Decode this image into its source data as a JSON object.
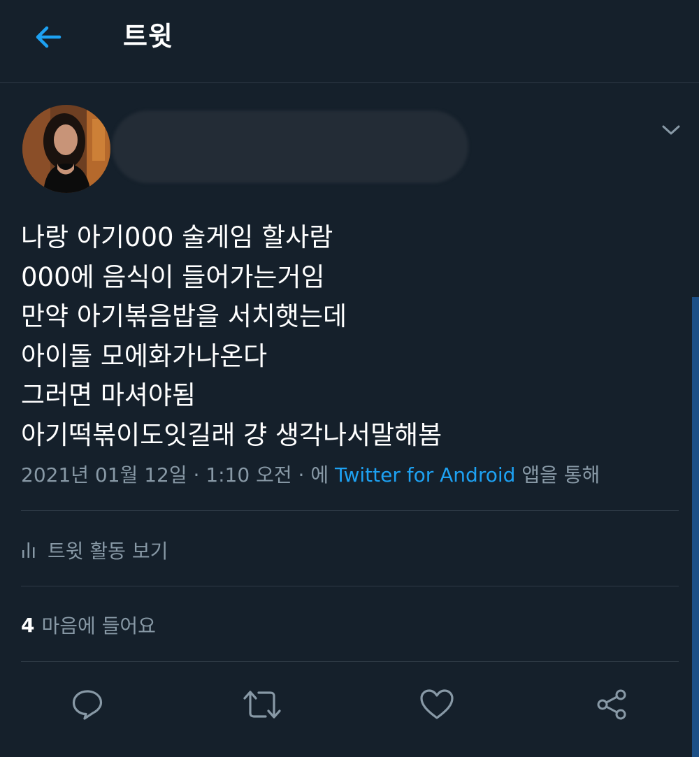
{
  "header": {
    "title": "트윗",
    "back_icon": "arrow-left-icon"
  },
  "tweet": {
    "lines": [
      "나랑 아기000 술게임 할사람",
      "000에 음식이 들어가는거임",
      "만약 아기볶음밥을 서치햇는데",
      "아이돌 모에화가나온다",
      "그러면 마셔야됨",
      "아기떡볶이도잇길래 걍 생각나서말해봄"
    ],
    "date": "2021년 01월 12일",
    "time": "1:10 오전",
    "via_prefix": "에",
    "source": "Twitter for Android",
    "via_suffix": "앱을 통해"
  },
  "activity": {
    "label": "트윗 활동 보기",
    "icon": "bar-chart-icon"
  },
  "likes": {
    "count": "4",
    "label": "마음에 들어요"
  },
  "actions": [
    {
      "name": "reply",
      "icon": "reply-bubble-icon"
    },
    {
      "name": "retweet",
      "icon": "retweet-icon"
    },
    {
      "name": "like",
      "icon": "heart-icon"
    },
    {
      "name": "share",
      "icon": "share-icon"
    }
  ],
  "colors": {
    "background": "#15202b",
    "accent": "#1da1f2",
    "secondary_text": "#8899a6",
    "divider": "#2f3b47"
  }
}
